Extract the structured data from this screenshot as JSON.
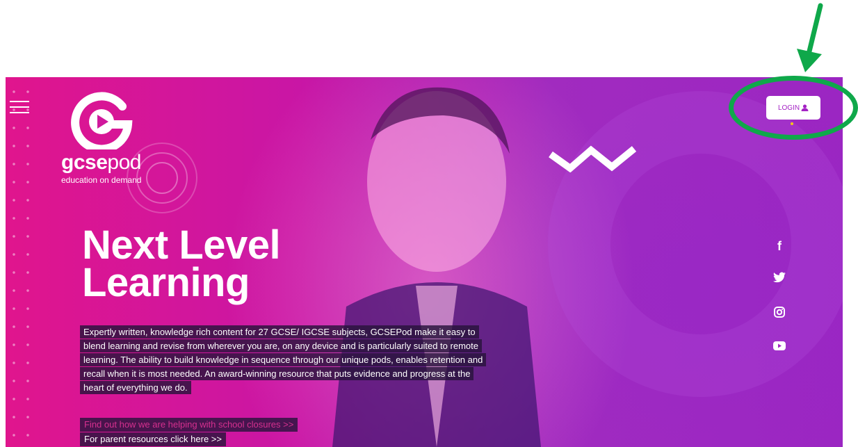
{
  "brand": {
    "name_bold": "gcse",
    "name_regular": "pod",
    "tagline": "education on demand"
  },
  "hero": {
    "headline_line1": "Next Level",
    "headline_line2": "Learning",
    "intro": "Expertly written, knowledge rich content for 27 GCSE/ IGCSE subjects, GCSEPod make it easy to blend learning and revise from wherever you are, on any device and is particularly suited to remote learning. The ability to build knowledge in sequence through our unique pods, enables retention and recall when it is most needed. An award-winning resource that puts evidence and progress at the heart of everything we do.",
    "link_closures": "Find out how we are helping with school closures >>",
    "link_parents": "For parent resources click here >>"
  },
  "header": {
    "login_label": "LOGIN"
  },
  "social": [
    {
      "icon": "facebook-icon",
      "glyph": "f"
    },
    {
      "icon": "twitter-icon"
    },
    {
      "icon": "instagram-icon"
    },
    {
      "icon": "youtube-icon"
    }
  ],
  "colors": {
    "hero_pink": "#e0158d",
    "hero_purple": "#9b26c2",
    "login_text": "#a422c4",
    "link_pink": "#d6308f",
    "annotation_green": "#0fa84a"
  }
}
